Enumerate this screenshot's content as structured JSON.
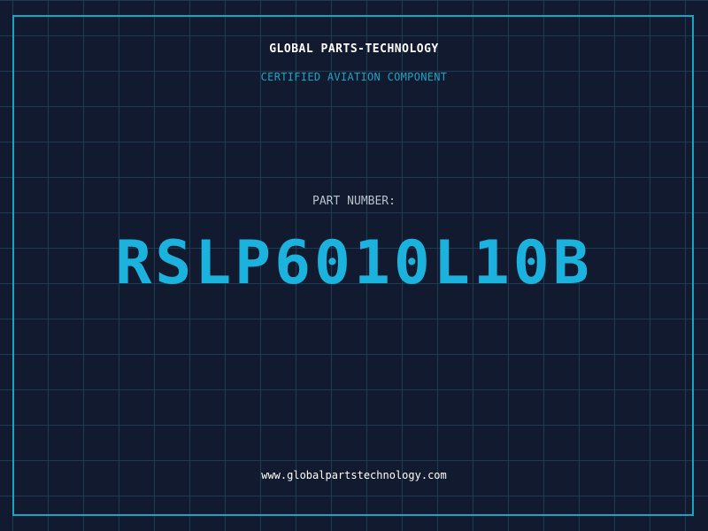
{
  "header": {
    "company": "GLOBAL PARTS-TECHNOLOGY",
    "subtitle": "CERTIFIED AVIATION COMPONENT"
  },
  "part": {
    "label": "PART NUMBER:",
    "number": "RSLP6010L10B"
  },
  "footer": {
    "url": "www.globalpartstechnology.com"
  },
  "colors": {
    "background": "#121a2f",
    "grid": "#1d3b53",
    "accent": "#1ba3c6",
    "part_number": "#1cb2de",
    "text": "#ffffff"
  }
}
